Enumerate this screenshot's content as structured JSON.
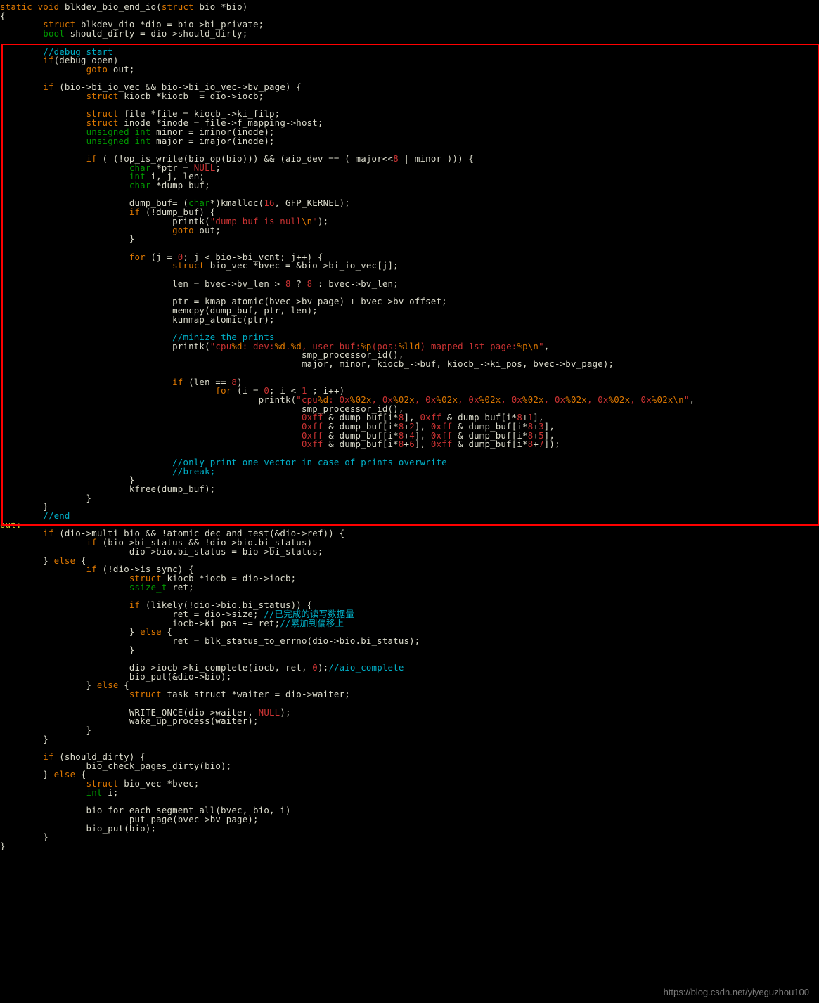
{
  "watermark": "https://blog.csdn.net/yiyeguzhou100",
  "code_lines": [
    [
      [
        "kw",
        "static"
      ],
      [
        "",
        " "
      ],
      [
        "kw",
        "void"
      ],
      [
        "",
        " blkdev_bio_end_io("
      ],
      [
        "kw",
        "struct"
      ],
      [
        "",
        " bio *bio)"
      ]
    ],
    [
      [
        "",
        "{"
      ]
    ],
    [
      [
        "",
        "        "
      ],
      [
        "kw",
        "struct"
      ],
      [
        "",
        " blkdev_dio *dio = bio->bi_private;"
      ]
    ],
    [
      [
        "",
        "        "
      ],
      [
        "type",
        "bool"
      ],
      [
        "",
        " should_dirty = dio->should_dirty;"
      ]
    ],
    [
      [
        "",
        ""
      ]
    ],
    [
      [
        "",
        "        "
      ],
      [
        "cmt",
        "//debug start"
      ]
    ],
    [
      [
        "",
        "        "
      ],
      [
        "kw",
        "if"
      ],
      [
        "",
        "(debug_open)"
      ]
    ],
    [
      [
        "",
        "                "
      ],
      [
        "kw",
        "goto"
      ],
      [
        "",
        " out;"
      ]
    ],
    [
      [
        "",
        ""
      ]
    ],
    [
      [
        "",
        "        "
      ],
      [
        "kw",
        "if"
      ],
      [
        "",
        " (bio->bi_io_vec && bio->bi_io_vec->bv_page) {"
      ]
    ],
    [
      [
        "",
        "                "
      ],
      [
        "kw",
        "struct"
      ],
      [
        "",
        " kiocb *kiocb_ = dio->iocb;"
      ]
    ],
    [
      [
        "",
        ""
      ]
    ],
    [
      [
        "",
        "                "
      ],
      [
        "kw",
        "struct"
      ],
      [
        "",
        " file *file = kiocb_->ki_filp;"
      ]
    ],
    [
      [
        "",
        "                "
      ],
      [
        "kw",
        "struct"
      ],
      [
        "",
        " inode *inode = file->f_mapping->host;"
      ]
    ],
    [
      [
        "",
        "                "
      ],
      [
        "type",
        "unsigned"
      ],
      [
        "",
        " "
      ],
      [
        "type",
        "int"
      ],
      [
        "",
        " minor = iminor(inode);"
      ]
    ],
    [
      [
        "",
        "                "
      ],
      [
        "type",
        "unsigned"
      ],
      [
        "",
        " "
      ],
      [
        "type",
        "int"
      ],
      [
        "",
        " major = imajor(inode);"
      ]
    ],
    [
      [
        "",
        ""
      ]
    ],
    [
      [
        "",
        "                "
      ],
      [
        "kw",
        "if"
      ],
      [
        "",
        " ( (!op_is_write(bio_op(bio))) && (aio_dev == ( major<<"
      ],
      [
        "num",
        "8"
      ],
      [
        "",
        " | minor ))) {"
      ]
    ],
    [
      [
        "",
        "                        "
      ],
      [
        "type",
        "char"
      ],
      [
        "",
        " *ptr = "
      ],
      [
        "num",
        "NULL"
      ],
      [
        "",
        ";"
      ]
    ],
    [
      [
        "",
        "                        "
      ],
      [
        "type",
        "int"
      ],
      [
        "",
        " i, j, len;"
      ]
    ],
    [
      [
        "",
        "                        "
      ],
      [
        "type",
        "char"
      ],
      [
        "",
        " *dump_buf;"
      ]
    ],
    [
      [
        "",
        ""
      ]
    ],
    [
      [
        "",
        "                        dump_buf= ("
      ],
      [
        "type",
        "char"
      ],
      [
        "",
        "*)kmalloc("
      ],
      [
        "num",
        "16"
      ],
      [
        "",
        ", GFP_KERNEL);"
      ]
    ],
    [
      [
        "",
        "                        "
      ],
      [
        "kw",
        "if"
      ],
      [
        "",
        " (!dump_buf) {"
      ]
    ],
    [
      [
        "",
        "                                printk("
      ],
      [
        "str",
        "\"dump_buf is null"
      ],
      [
        "fmt",
        "\\n"
      ],
      [
        "str",
        "\""
      ],
      [
        "",
        ");"
      ]
    ],
    [
      [
        "",
        "                                "
      ],
      [
        "kw",
        "goto"
      ],
      [
        "",
        " out;"
      ]
    ],
    [
      [
        "",
        "                        }"
      ]
    ],
    [
      [
        "",
        ""
      ]
    ],
    [
      [
        "",
        "                        "
      ],
      [
        "kw",
        "for"
      ],
      [
        "",
        " (j = "
      ],
      [
        "num",
        "0"
      ],
      [
        "",
        "; j < bio->bi_vcnt; j++) {"
      ]
    ],
    [
      [
        "",
        "                                "
      ],
      [
        "kw",
        "struct"
      ],
      [
        "",
        " bio_vec *bvec = &bio->bi_io_vec[j];"
      ]
    ],
    [
      [
        "",
        ""
      ]
    ],
    [
      [
        "",
        "                                len = bvec->bv_len > "
      ],
      [
        "num",
        "8"
      ],
      [
        "",
        " ? "
      ],
      [
        "num",
        "8"
      ],
      [
        "",
        " : bvec->bv_len;"
      ]
    ],
    [
      [
        "",
        ""
      ]
    ],
    [
      [
        "",
        "                                ptr = kmap_atomic(bvec->bv_page) + bvec->bv_offset;"
      ]
    ],
    [
      [
        "",
        "                                memcpy(dump_buf, ptr, len);"
      ]
    ],
    [
      [
        "",
        "                                kunmap_atomic(ptr);"
      ]
    ],
    [
      [
        "",
        ""
      ]
    ],
    [
      [
        "",
        "                                "
      ],
      [
        "cmt",
        "//minize the prints"
      ]
    ],
    [
      [
        "",
        "                                printk("
      ],
      [
        "str",
        "\"cpu"
      ],
      [
        "fmt",
        "%d"
      ],
      [
        "str",
        ": dev:"
      ],
      [
        "fmt",
        "%d"
      ],
      [
        "str",
        "."
      ],
      [
        "fmt",
        "%d"
      ],
      [
        "str",
        ", user_buf:"
      ],
      [
        "fmt",
        "%p"
      ],
      [
        "str",
        "(pos:"
      ],
      [
        "fmt",
        "%lld"
      ],
      [
        "str",
        ") mapped 1st page:"
      ],
      [
        "fmt",
        "%p\\n"
      ],
      [
        "str",
        "\""
      ],
      [
        "",
        ","
      ]
    ],
    [
      [
        "",
        "                                                        smp_processor_id(),"
      ]
    ],
    [
      [
        "",
        "                                                        major, minor, kiocb_->buf, kiocb_->ki_pos, bvec->bv_page);"
      ]
    ],
    [
      [
        "",
        ""
      ]
    ],
    [
      [
        "",
        "                                "
      ],
      [
        "kw",
        "if"
      ],
      [
        "",
        " (len == "
      ],
      [
        "num",
        "8"
      ],
      [
        "",
        ")"
      ]
    ],
    [
      [
        "",
        "                                        "
      ],
      [
        "kw",
        "for"
      ],
      [
        "",
        " (i = "
      ],
      [
        "num",
        "0"
      ],
      [
        "",
        "; i < "
      ],
      [
        "num",
        "1"
      ],
      [
        "",
        " ; i++)"
      ]
    ],
    [
      [
        "",
        "                                                printk("
      ],
      [
        "str",
        "\"cpu"
      ],
      [
        "fmt",
        "%d"
      ],
      [
        "str",
        ": 0x"
      ],
      [
        "fmt",
        "%02x"
      ],
      [
        "str",
        ", 0x"
      ],
      [
        "fmt",
        "%02x"
      ],
      [
        "str",
        ", 0x"
      ],
      [
        "fmt",
        "%02x"
      ],
      [
        "str",
        ", 0x"
      ],
      [
        "fmt",
        "%02x"
      ],
      [
        "str",
        ", 0x"
      ],
      [
        "fmt",
        "%02x"
      ],
      [
        "str",
        ", 0x"
      ],
      [
        "fmt",
        "%02x"
      ],
      [
        "str",
        ", 0x"
      ],
      [
        "fmt",
        "%02x"
      ],
      [
        "str",
        ", 0x"
      ],
      [
        "fmt",
        "%02x\\n"
      ],
      [
        "str",
        "\""
      ],
      [
        "",
        ","
      ]
    ],
    [
      [
        "",
        "                                                        smp_processor_id(),"
      ]
    ],
    [
      [
        "",
        "                                                        "
      ],
      [
        "num",
        "0xff"
      ],
      [
        "",
        " & dump_buf[i*"
      ],
      [
        "num",
        "8"
      ],
      [
        "",
        "], "
      ],
      [
        "num",
        "0xff"
      ],
      [
        "",
        " & dump_buf[i*"
      ],
      [
        "num",
        "8"
      ],
      [
        "",
        "+"
      ],
      [
        "num",
        "1"
      ],
      [
        "",
        "],"
      ]
    ],
    [
      [
        "",
        "                                                        "
      ],
      [
        "num",
        "0xff"
      ],
      [
        "",
        " & dump_buf[i*"
      ],
      [
        "num",
        "8"
      ],
      [
        "",
        "+"
      ],
      [
        "num",
        "2"
      ],
      [
        "",
        "], "
      ],
      [
        "num",
        "0xff"
      ],
      [
        "",
        " & dump_buf[i*"
      ],
      [
        "num",
        "8"
      ],
      [
        "",
        "+"
      ],
      [
        "num",
        "3"
      ],
      [
        "",
        "],"
      ]
    ],
    [
      [
        "",
        "                                                        "
      ],
      [
        "num",
        "0xff"
      ],
      [
        "",
        " & dump_buf[i*"
      ],
      [
        "num",
        "8"
      ],
      [
        "",
        "+"
      ],
      [
        "num",
        "4"
      ],
      [
        "",
        "], "
      ],
      [
        "num",
        "0xff"
      ],
      [
        "",
        " & dump_buf[i*"
      ],
      [
        "num",
        "8"
      ],
      [
        "",
        "+"
      ],
      [
        "num",
        "5"
      ],
      [
        "",
        "],"
      ]
    ],
    [
      [
        "",
        "                                                        "
      ],
      [
        "num",
        "0xff"
      ],
      [
        "",
        " & dump_buf[i*"
      ],
      [
        "num",
        "8"
      ],
      [
        "",
        "+"
      ],
      [
        "num",
        "6"
      ],
      [
        "",
        "], "
      ],
      [
        "num",
        "0xff"
      ],
      [
        "",
        " & dump_buf[i*"
      ],
      [
        "num",
        "8"
      ],
      [
        "",
        "+"
      ],
      [
        "num",
        "7"
      ],
      [
        "",
        "]);"
      ]
    ],
    [
      [
        "",
        ""
      ]
    ],
    [
      [
        "",
        "                                "
      ],
      [
        "cmt",
        "//only print one vector in case of prints overwrite"
      ]
    ],
    [
      [
        "",
        "                                "
      ],
      [
        "cmt",
        "//break;"
      ]
    ],
    [
      [
        "",
        "                        }"
      ]
    ],
    [
      [
        "",
        "                        kfree(dump_buf);"
      ]
    ],
    [
      [
        "",
        "                }"
      ]
    ],
    [
      [
        "",
        "        }"
      ]
    ],
    [
      [
        "",
        "        "
      ],
      [
        "cmt",
        "//end"
      ]
    ],
    [
      [
        "lbl",
        "out:"
      ]
    ],
    [
      [
        "",
        "        "
      ],
      [
        "kw",
        "if"
      ],
      [
        "",
        " (dio->multi_bio && !atomic_dec_and_test(&dio->ref)) {"
      ]
    ],
    [
      [
        "",
        "                "
      ],
      [
        "kw",
        "if"
      ],
      [
        "",
        " (bio->bi_status && !dio->bio.bi_status)"
      ]
    ],
    [
      [
        "",
        "                        dio->bio.bi_status = bio->bi_status;"
      ]
    ],
    [
      [
        "",
        "        } "
      ],
      [
        "kw",
        "else"
      ],
      [
        "",
        " {"
      ]
    ],
    [
      [
        "",
        "                "
      ],
      [
        "kw",
        "if"
      ],
      [
        "",
        " (!dio->is_sync) {"
      ]
    ],
    [
      [
        "",
        "                        "
      ],
      [
        "kw",
        "struct"
      ],
      [
        "",
        " kiocb *iocb = dio->iocb;"
      ]
    ],
    [
      [
        "",
        "                        "
      ],
      [
        "type",
        "ssize_t"
      ],
      [
        "",
        " ret;"
      ]
    ],
    [
      [
        "",
        ""
      ]
    ],
    [
      [
        "",
        "                        "
      ],
      [
        "kw",
        "if"
      ],
      [
        "",
        " (likely(!dio->bio.bi_status)) {"
      ]
    ],
    [
      [
        "",
        "                                ret = dio->size; "
      ],
      [
        "cmt",
        "//已完成的读写数据量"
      ]
    ],
    [
      [
        "",
        "                                iocb->ki_pos += ret;"
      ],
      [
        "cmt",
        "//累加到偏移上"
      ]
    ],
    [
      [
        "",
        "                        } "
      ],
      [
        "kw",
        "else"
      ],
      [
        "",
        " {"
      ]
    ],
    [
      [
        "",
        "                                ret = blk_status_to_errno(dio->bio.bi_status);"
      ]
    ],
    [
      [
        "",
        "                        }"
      ]
    ],
    [
      [
        "",
        ""
      ]
    ],
    [
      [
        "",
        "                        dio->iocb->ki_complete(iocb, ret, "
      ],
      [
        "num",
        "0"
      ],
      [
        "",
        ");"
      ],
      [
        "cmt",
        "//aio_complete"
      ]
    ],
    [
      [
        "",
        "                        bio_put(&dio->bio);"
      ]
    ],
    [
      [
        "",
        "                } "
      ],
      [
        "kw",
        "else"
      ],
      [
        "",
        " {"
      ]
    ],
    [
      [
        "",
        "                        "
      ],
      [
        "kw",
        "struct"
      ],
      [
        "",
        " task_struct *waiter = dio->waiter;"
      ]
    ],
    [
      [
        "",
        ""
      ]
    ],
    [
      [
        "",
        "                        WRITE_ONCE(dio->waiter, "
      ],
      [
        "num",
        "NULL"
      ],
      [
        "",
        ");"
      ]
    ],
    [
      [
        "",
        "                        wake_up_process(waiter);"
      ]
    ],
    [
      [
        "",
        "                }"
      ]
    ],
    [
      [
        "",
        "        }"
      ]
    ],
    [
      [
        "",
        ""
      ]
    ],
    [
      [
        "",
        "        "
      ],
      [
        "kw",
        "if"
      ],
      [
        "",
        " (should_dirty) {"
      ]
    ],
    [
      [
        "",
        "                bio_check_pages_dirty(bio);"
      ]
    ],
    [
      [
        "",
        "        } "
      ],
      [
        "kw",
        "else"
      ],
      [
        "",
        " {"
      ]
    ],
    [
      [
        "",
        "                "
      ],
      [
        "kw",
        "struct"
      ],
      [
        "",
        " bio_vec *bvec;"
      ]
    ],
    [
      [
        "",
        "                "
      ],
      [
        "type",
        "int"
      ],
      [
        "",
        " i;"
      ]
    ],
    [
      [
        "",
        ""
      ]
    ],
    [
      [
        "",
        "                bio_for_each_segment_all(bvec, bio, i)"
      ]
    ],
    [
      [
        "",
        "                        put_page(bvec->bv_page);"
      ]
    ],
    [
      [
        "",
        "                bio_put(bio);"
      ]
    ],
    [
      [
        "",
        "        }"
      ]
    ],
    [
      [
        "",
        "}"
      ]
    ]
  ]
}
